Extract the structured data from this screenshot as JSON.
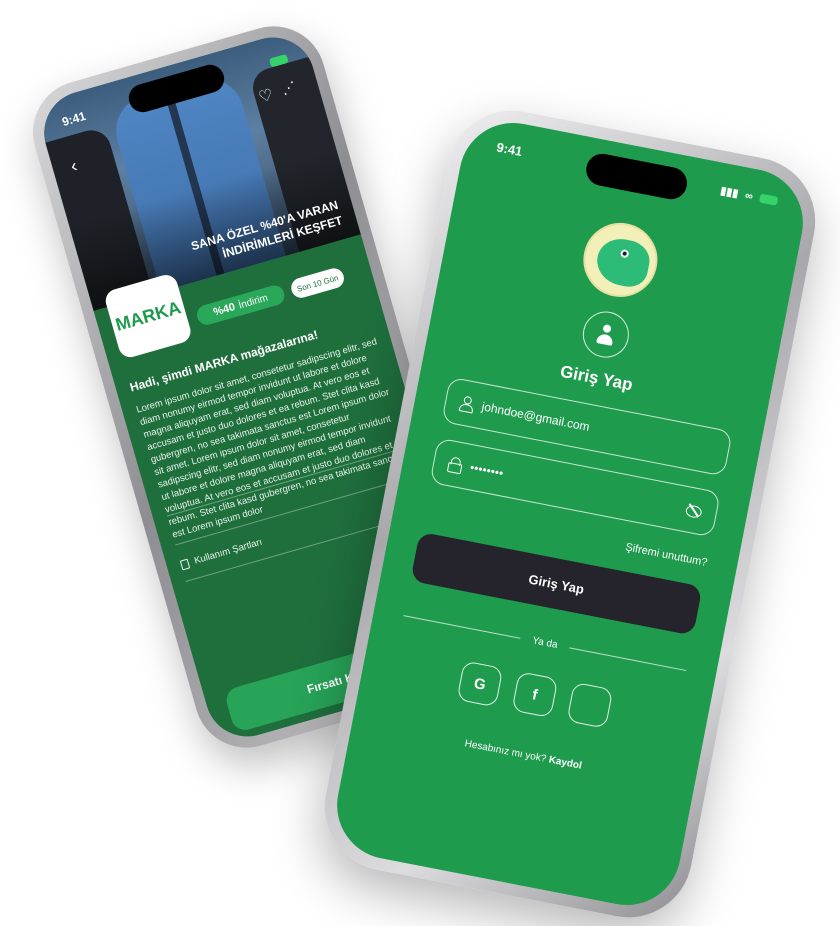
{
  "back_screen": {
    "status": {
      "time": "9:41"
    },
    "hero_title_line1": "SANA ÖZEL %40'A VARAN",
    "hero_title_line2": "İNDİRİMLERİ KEŞFET",
    "brand_logo": "MARKA",
    "discount_value": "%40",
    "discount_label": "İndirim",
    "days_badge": "Son 10 Gün",
    "heading": "Hadi, şimdi MARKA mağazalarına!",
    "body": "Lorem ipsum dolor sit amet, consetetur sadipscing elitr, sed diam nonumy eirmod tempor invidunt ut labore et dolore magna aliquyam erat, sed diam voluptua. At vero eos et accusam et justo duo dolores et ea rebum. Stet clita kasd gubergren, no sea takimata sanctus est Lorem ipsum dolor sit amet. Lorem ipsum dolor sit amet, consetetur sadipscing elitr, sed diam nonumy eirmod tempor invidunt ut labore et dolore magna aliquyam erat, sed diam voluptua. At vero eos et accusam et justo duo dolores et ea rebum. Stet clita kasd gubergren, no sea takimata sanctus est Lorem ipsum dolor",
    "terms_label": "Kullanım Şartları",
    "cta_label": "Fırsatı Kullan"
  },
  "front_screen": {
    "status": {
      "time": "9:41"
    },
    "title": "Giriş Yap",
    "email_value": "johndoe@gmail.com",
    "password_value": "••••••••",
    "forgot_label": "Şifremi unuttum?",
    "login_button": "Giriş Yap",
    "or_label": "Ya da",
    "social": [
      {
        "label": "G",
        "icon": "google-icon"
      },
      {
        "label": "f",
        "icon": "facebook-icon"
      },
      {
        "label": "",
        "icon": "apple-icon"
      }
    ],
    "signup_prompt": "Hesabınız mı yok?",
    "signup_link": "Kaydol"
  },
  "colors": {
    "brand_green": "#1f9b4d",
    "dark_green": "#1f6f3d",
    "button_dark": "#25232c"
  }
}
